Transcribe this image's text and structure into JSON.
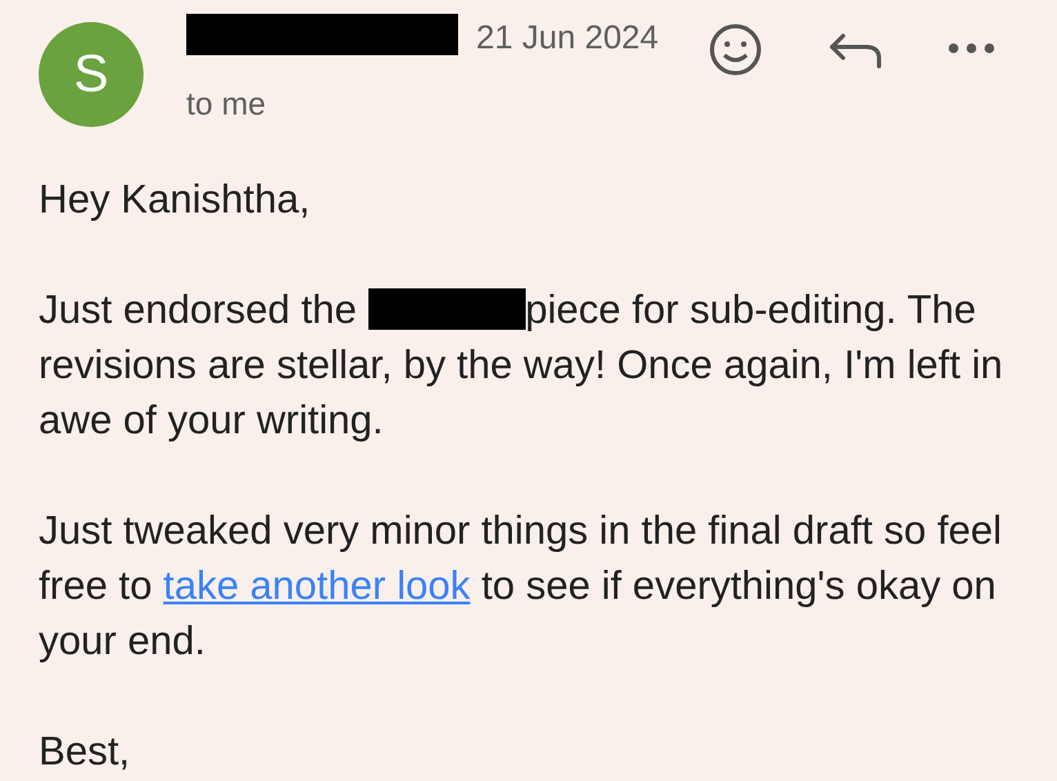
{
  "header": {
    "avatar_letter": "S",
    "sender_redacted": true,
    "date": "21 Jun 2024",
    "recipient": "to me"
  },
  "body": [
    [
      {
        "kind": "text",
        "text": "Hey Kanishtha,"
      }
    ],
    [
      {
        "kind": "text",
        "text": "Just endorsed the "
      },
      {
        "kind": "redaction"
      },
      {
        "kind": "text",
        "text": "piece for sub-editing. The revisions are stellar, by the way! Once again, I'm left in awe of your writing."
      }
    ],
    [
      {
        "kind": "text",
        "text": "Just tweaked very minor things in the final draft so feel free to "
      },
      {
        "kind": "link",
        "text": "take another look"
      },
      {
        "kind": "text",
        "text": " to see if everything's okay on your end."
      }
    ],
    [
      {
        "kind": "text",
        "text": "Best,"
      }
    ]
  ]
}
